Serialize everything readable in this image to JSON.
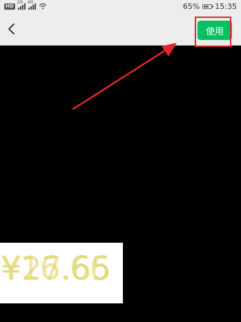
{
  "status_bar": {
    "hd_badge": "HD",
    "network_1": "2G",
    "network_2": "4G",
    "battery_percent": "65%",
    "time": "15:35"
  },
  "navbar": {
    "use_button_label": "使用"
  },
  "preview": {
    "price_text_1": "¥16.66",
    "price_text_2": "¥27.65"
  },
  "colors": {
    "accent_green": "#07c160",
    "annotation_red": "#e3262c",
    "bar_bg": "#ededed"
  }
}
